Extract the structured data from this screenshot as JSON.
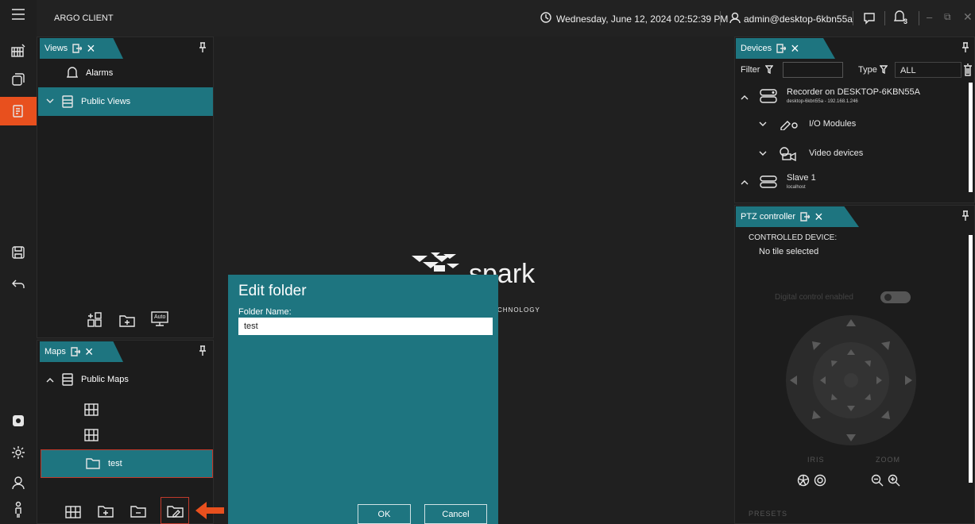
{
  "app": {
    "title": "ARGO CLIENT",
    "datetime": "Wednesday, June 12, 2024 02:52:39 PM",
    "user": "admin@desktop-6kbn55a",
    "alarm_count": "3"
  },
  "rail": {
    "icons": [
      "menu-icon",
      "video-wall-icon",
      "layers-icon",
      "tasks-icon",
      "save-icon",
      "undo-icon",
      "settings-icon",
      "gear-icon",
      "user-icon",
      "person-icon"
    ]
  },
  "views_panel": {
    "tab_label": "Views",
    "items": [
      {
        "label": "Alarms",
        "icon": "bell-icon"
      },
      {
        "label": "Public Views",
        "icon": "server-icon"
      }
    ]
  },
  "maps_panel": {
    "tab_label": "Maps",
    "root_label": "Public Maps",
    "folder_label": "test"
  },
  "auto_label": "Auto",
  "logo": {
    "word": "spark",
    "tagline_fragment": "CHNOLOGY"
  },
  "dialog": {
    "title": "Edit folder",
    "field_label": "Folder Name:",
    "field_value": "test",
    "ok_label": "OK",
    "cancel_label": "Cancel"
  },
  "devices_panel": {
    "tab_label": "Devices",
    "filter_label": "Filter",
    "type_label": "Type",
    "type_value": "ALL",
    "recorder_name": "Recorder on DESKTOP-6KBN55A",
    "recorder_sub": "desktop-6kbn55a - 192.168.1.246",
    "io_label": "I/O Modules",
    "video_label": "Video devices",
    "slave_name": "Slave 1",
    "slave_sub": "localhost"
  },
  "ptz_panel": {
    "tab_label": "PTZ controller",
    "controlled_label": "CONTROLLED DEVICE:",
    "controlled_value": "No tile selected",
    "toggle_label": "Digital control enabled",
    "iris_label": "IRIS",
    "zoom_label": "ZOOM",
    "presets_label": "PRESETS"
  },
  "colors": {
    "accent": "#1e7580",
    "active_rail": "#e8501e",
    "highlight_arrow": "#e8501e"
  }
}
